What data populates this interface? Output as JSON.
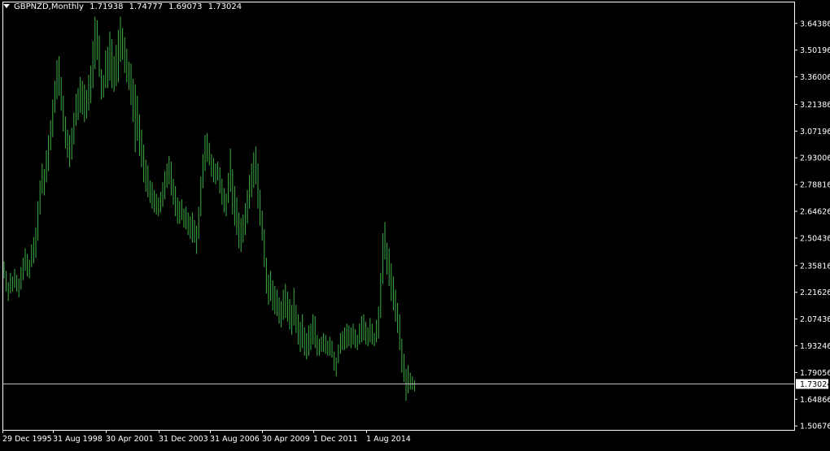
{
  "header": {
    "symbol_timeframe": "GBPNZD,Monthly",
    "open": "1.71938",
    "high": "1.74777",
    "low": "1.69073",
    "close": "1.73024"
  },
  "colors": {
    "background": "#000000",
    "bar": "#3cb043",
    "axis": "#ffffff",
    "price_line": "#c0c0c0"
  },
  "chart_data": {
    "type": "ohlc",
    "title": "GBPNZD,Monthly",
    "ylim": [
      1.486,
      3.755
    ],
    "y_ticks": [
      "3.64386",
      "3.50196",
      "3.36006",
      "3.21386",
      "3.07196",
      "2.93006",
      "2.78816",
      "2.64626",
      "2.50436",
      "2.35816",
      "2.21626",
      "2.07436",
      "1.93246",
      "1.79056",
      "1.64866",
      "1.50676"
    ],
    "x_ticks": [
      "29 Dec 1995",
      "31 Aug 1998",
      "30 Apr 2001",
      "31 Dec 2003",
      "31 Aug 2006",
      "30 Apr 2009",
      "1 Dec 2011",
      "1 Aug 2014"
    ],
    "last_price": "1.73024",
    "bars": [
      [
        2.38,
        2.29
      ],
      [
        2.33,
        2.22
      ],
      [
        2.27,
        2.17
      ],
      [
        2.32,
        2.21
      ],
      [
        2.3,
        2.22
      ],
      [
        2.34,
        2.24
      ],
      [
        2.31,
        2.22
      ],
      [
        2.29,
        2.19
      ],
      [
        2.35,
        2.23
      ],
      [
        2.4,
        2.28
      ],
      [
        2.45,
        2.33
      ],
      [
        2.42,
        2.3
      ],
      [
        2.39,
        2.29
      ],
      [
        2.47,
        2.35
      ],
      [
        2.51,
        2.37
      ],
      [
        2.56,
        2.4
      ],
      [
        2.7,
        2.49
      ],
      [
        2.81,
        2.63
      ],
      [
        2.9,
        2.74
      ],
      [
        2.87,
        2.73
      ],
      [
        2.97,
        2.8
      ],
      [
        3.05,
        2.86
      ],
      [
        3.13,
        2.97
      ],
      [
        3.24,
        3.04
      ],
      [
        3.34,
        3.17
      ],
      [
        3.45,
        3.24
      ],
      [
        3.47,
        3.26
      ],
      [
        3.36,
        3.18
      ],
      [
        3.26,
        3.07
      ],
      [
        3.15,
        2.98
      ],
      [
        3.08,
        2.93
      ],
      [
        3.05,
        2.88
      ],
      [
        3.09,
        2.92
      ],
      [
        3.17,
        3.0
      ],
      [
        3.27,
        3.1
      ],
      [
        3.3,
        3.13
      ],
      [
        3.36,
        3.17
      ],
      [
        3.34,
        3.16
      ],
      [
        3.32,
        3.12
      ],
      [
        3.29,
        3.14
      ],
      [
        3.37,
        3.18
      ],
      [
        3.42,
        3.22
      ],
      [
        3.55,
        3.3
      ],
      [
        3.68,
        3.4
      ],
      [
        3.66,
        3.45
      ],
      [
        3.58,
        3.36
      ],
      [
        3.4,
        3.24
      ],
      [
        3.37,
        3.25
      ],
      [
        3.5,
        3.3
      ],
      [
        3.52,
        3.3
      ],
      [
        3.6,
        3.34
      ],
      [
        3.56,
        3.3
      ],
      [
        3.47,
        3.28
      ],
      [
        3.53,
        3.31
      ],
      [
        3.61,
        3.33
      ],
      [
        3.68,
        3.44
      ],
      [
        3.62,
        3.45
      ],
      [
        3.57,
        3.38
      ],
      [
        3.51,
        3.33
      ],
      [
        3.44,
        3.29
      ],
      [
        3.43,
        3.21
      ],
      [
        3.35,
        3.12
      ],
      [
        3.32,
        2.96
      ],
      [
        3.26,
        3.02
      ],
      [
        3.16,
        2.94
      ],
      [
        3.08,
        2.88
      ],
      [
        3.0,
        2.8
      ],
      [
        2.92,
        2.75
      ],
      [
        2.89,
        2.72
      ],
      [
        2.81,
        2.69
      ],
      [
        2.8,
        2.66
      ],
      [
        2.76,
        2.64
      ],
      [
        2.74,
        2.63
      ],
      [
        2.72,
        2.62
      ],
      [
        2.75,
        2.64
      ],
      [
        2.8,
        2.67
      ],
      [
        2.86,
        2.71
      ],
      [
        2.9,
        2.77
      ],
      [
        2.94,
        2.79
      ],
      [
        2.91,
        2.73
      ],
      [
        2.82,
        2.68
      ],
      [
        2.78,
        2.62
      ],
      [
        2.72,
        2.58
      ],
      [
        2.7,
        2.58
      ],
      [
        2.71,
        2.6
      ],
      [
        2.66,
        2.56
      ],
      [
        2.67,
        2.55
      ],
      [
        2.64,
        2.52
      ],
      [
        2.62,
        2.5
      ],
      [
        2.64,
        2.48
      ],
      [
        2.6,
        2.48
      ],
      [
        2.57,
        2.42
      ],
      [
        2.67,
        2.5
      ],
      [
        2.83,
        2.62
      ],
      [
        2.95,
        2.77
      ],
      [
        3.05,
        2.86
      ],
      [
        3.06,
        2.91
      ],
      [
        3.01,
        2.89
      ],
      [
        2.95,
        2.83
      ],
      [
        2.93,
        2.8
      ],
      [
        2.9,
        2.79
      ],
      [
        2.91,
        2.81
      ],
      [
        2.88,
        2.74
      ],
      [
        2.82,
        2.68
      ],
      [
        2.77,
        2.64
      ],
      [
        2.74,
        2.62
      ],
      [
        2.85,
        2.69
      ],
      [
        2.98,
        2.75
      ],
      [
        2.87,
        2.63
      ],
      [
        2.78,
        2.57
      ],
      [
        2.72,
        2.52
      ],
      [
        2.64,
        2.45
      ],
      [
        2.61,
        2.43
      ],
      [
        2.63,
        2.48
      ],
      [
        2.69,
        2.52
      ],
      [
        2.76,
        2.58
      ],
      [
        2.84,
        2.66
      ],
      [
        2.9,
        2.72
      ],
      [
        2.96,
        2.77
      ],
      [
        2.99,
        2.79
      ],
      [
        2.9,
        2.66
      ],
      [
        2.76,
        2.57
      ],
      [
        2.65,
        2.49
      ],
      [
        2.55,
        2.35
      ],
      [
        2.4,
        2.21
      ],
      [
        2.31,
        2.15
      ],
      [
        2.33,
        2.17
      ],
      [
        2.28,
        2.12
      ],
      [
        2.25,
        2.1
      ],
      [
        2.23,
        2.09
      ],
      [
        2.19,
        2.05
      ],
      [
        2.17,
        2.03
      ],
      [
        2.23,
        2.07
      ],
      [
        2.26,
        2.08
      ],
      [
        2.22,
        2.06
      ],
      [
        2.18,
        2.02
      ],
      [
        2.15,
        1.99
      ],
      [
        2.24,
        2.04
      ],
      [
        2.15,
        2.0
      ],
      [
        2.1,
        1.94
      ],
      [
        2.06,
        1.9
      ],
      [
        2.1,
        1.92
      ],
      [
        2.03,
        1.88
      ],
      [
        2.0,
        1.86
      ],
      [
        2.04,
        1.88
      ],
      [
        2.05,
        1.91
      ],
      [
        2.1,
        1.94
      ],
      [
        2.09,
        1.92
      ],
      [
        1.99,
        1.88
      ],
      [
        1.97,
        1.88
      ],
      [
        1.98,
        1.9
      ],
      [
        2.0,
        1.9
      ],
      [
        1.99,
        1.89
      ],
      [
        1.96,
        1.88
      ],
      [
        1.98,
        1.88
      ],
      [
        1.96,
        1.87
      ],
      [
        1.9,
        1.8
      ],
      [
        1.87,
        1.77
      ],
      [
        1.94,
        1.84
      ],
      [
        2.0,
        1.89
      ],
      [
        2.01,
        1.91
      ],
      [
        2.03,
        1.91
      ],
      [
        2.05,
        1.92
      ],
      [
        2.04,
        1.93
      ],
      [
        2.03,
        1.92
      ],
      [
        2.05,
        1.94
      ],
      [
        2.02,
        1.92
      ],
      [
        1.99,
        1.91
      ],
      [
        2.05,
        1.94
      ],
      [
        2.09,
        1.95
      ],
      [
        2.1,
        1.96
      ],
      [
        2.06,
        1.94
      ],
      [
        2.03,
        1.93
      ],
      [
        2.08,
        1.95
      ],
      [
        2.05,
        1.94
      ],
      [
        2.0,
        1.93
      ],
      [
        2.07,
        1.95
      ],
      [
        2.14,
        1.97
      ],
      [
        2.32,
        2.08
      ],
      [
        2.53,
        2.26
      ],
      [
        2.59,
        2.39
      ],
      [
        2.48,
        2.31
      ],
      [
        2.45,
        2.25
      ],
      [
        2.37,
        2.17
      ],
      [
        2.3,
        2.12
      ],
      [
        2.23,
        2.06
      ],
      [
        2.16,
        2.0
      ],
      [
        2.1,
        1.91
      ],
      [
        1.97,
        1.79
      ],
      [
        1.89,
        1.74
      ],
      [
        1.81,
        1.64
      ],
      [
        1.83,
        1.68
      ],
      [
        1.79,
        1.7
      ],
      [
        1.77,
        1.7
      ],
      [
        1.75,
        1.69
      ]
    ]
  }
}
